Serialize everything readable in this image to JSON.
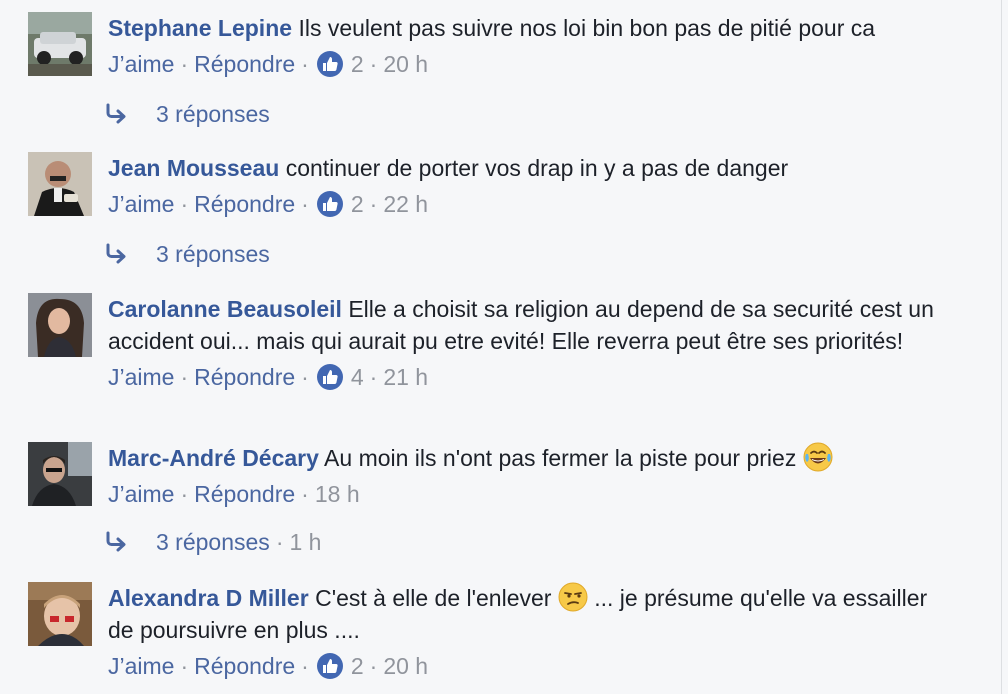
{
  "comments": [
    {
      "author": "Stephane Lepine",
      "text": "Ils veulent pas suivre nos loi bin bon pas de pitié pour ca",
      "like_label": "J’aime",
      "reply_label": "Répondre",
      "reactions": "2",
      "time": "20 h",
      "replies": "3 réponses"
    },
    {
      "author": "Jean Mousseau",
      "text": "continuer de porter vos drap in y a pas de danger",
      "like_label": "J’aime",
      "reply_label": "Répondre",
      "reactions": "2",
      "time": "22 h",
      "replies": "3 réponses"
    },
    {
      "author": "Carolanne Beausoleil",
      "text": "Elle a choisit sa religion au depend de sa securité cest un accident oui... mais qui aurait pu etre evité! Elle reverra peut être ses priorités!",
      "like_label": "J’aime",
      "reply_label": "Répondre",
      "reactions": "4",
      "time": "21 h"
    },
    {
      "author": "Marc-André Décary",
      "text": "Au moin ils n'ont pas fermer la piste pour priez",
      "emoji": "tears-of-joy",
      "like_label": "J’aime",
      "reply_label": "Répondre",
      "time": "18 h",
      "replies": "3 réponses",
      "replies_time": "1 h"
    },
    {
      "author": "Alexandra D Miller",
      "text_before": "C'est à elle de l'enlever",
      "emoji": "unamused-face",
      "text_after": "... je présume qu'elle va essailler de poursuivre en plus ....",
      "like_label": "J’aime",
      "reply_label": "Répondre",
      "reactions": "2",
      "time": "20 h"
    }
  ],
  "icons": {
    "like": "thumbs-up-icon",
    "reply": "reply-arrow-icon"
  },
  "colors": {
    "author": "#365899",
    "link": "#4b67a1",
    "meta": "#90949c",
    "like_badge": "#4267b2",
    "background": "#f6f7f9"
  }
}
